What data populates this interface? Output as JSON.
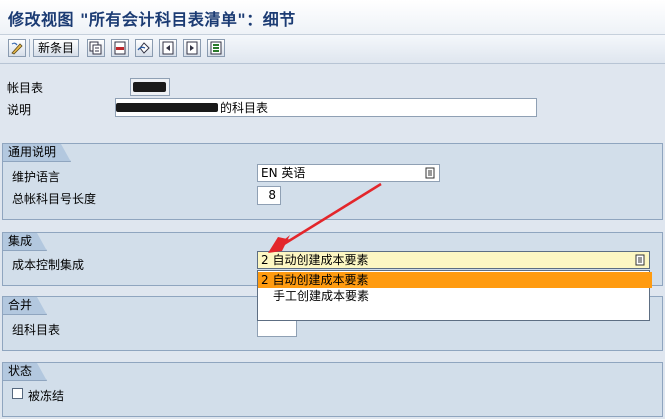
{
  "window": {
    "title": "修改视图 \"所有会计科目表清单\"：细节"
  },
  "toolbar": {
    "new_entries_label": "新条目",
    "icons": [
      "display-change-icon",
      "copy-icon",
      "delete-icon",
      "undo-icon",
      "previous-entry-icon",
      "next-entry-icon",
      "select-all-icon"
    ]
  },
  "header_fields": {
    "chart_of_accounts_label": "帐目表",
    "description_label": "说明",
    "description_value_visible": "的科目表"
  },
  "general_section": {
    "title": "通用说明",
    "maintenance_language_label": "维护语言",
    "maintenance_language_value": "EN 英语",
    "gl_account_length_label": "总帐科目号长度",
    "gl_account_length_value": "8"
  },
  "integration_section": {
    "title": "集成",
    "controlling_integration_label": "成本控制集成",
    "controlling_integration_value": "2 自动创建成本要素",
    "options": [
      {
        "label": "2 自动创建成本要素",
        "selected": true
      },
      {
        "label": "手工创建成本要素",
        "selected": false
      }
    ]
  },
  "consolidation_section": {
    "title": "合并",
    "group_chart_label": "组科目表"
  },
  "status_section": {
    "title": "状态",
    "blocked_label": "被冻结",
    "blocked_checked": false
  },
  "colors": {
    "annotation_arrow": "#e3262b",
    "selected_option": "#ff9b10",
    "dropdown_field_bg": "#fdf7c3",
    "title_text": "#1b3b73"
  }
}
